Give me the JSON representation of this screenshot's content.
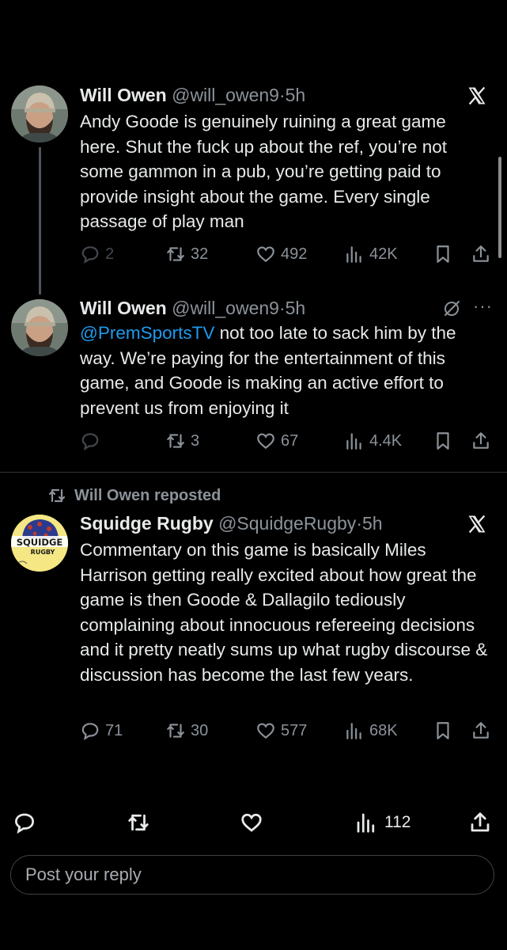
{
  "posts": [
    {
      "name": "Will Owen",
      "handle": "@will_owen9",
      "dot": "·",
      "time": "5h",
      "text": "Andy Goode is genuinely ruining a great game here. Shut the fuck up about the ref, you’re not some gammon in a pub, you’re getting paid to provide insight about the game. Every single passage of play man",
      "replies": "2",
      "reposts": "32",
      "likes": "492",
      "views": "42K"
    },
    {
      "name": "Will Owen",
      "handle": "@will_owen9",
      "dot": "·",
      "time": "5h",
      "mention": "@PremSportsTV",
      "text": " not too late to sack him by the way. We’re paying for the entertainment of this game, and Goode is making an active effort to prevent us from enjoying it",
      "more": "···",
      "replies": "",
      "reposts": "3",
      "likes": "67",
      "views": "4.4K"
    },
    {
      "repost_label": "Will Owen reposted",
      "name": "Squidge Rugby",
      "handle": "@SquidgeRugby",
      "dot": "·",
      "time": "5h",
      "avatar_text": [
        "SQUIDGE",
        "RUGBY"
      ],
      "text": "Commentary on this game is basically Miles Harrison getting really excited about how great the game is then Goode & Dallagilo tediously complaining about innocuous refereeing decisions and it pretty neatly sums up what rugby discourse & discussion has become the last few years.",
      "replies": "71",
      "reposts": "30",
      "likes": "577",
      "views": "68K"
    }
  ],
  "bottom_bar": {
    "views": "112"
  },
  "reply": {
    "placeholder": "Post your reply"
  },
  "colors": {
    "background": "#000000",
    "text": "#e7e9ea",
    "muted": "#8b9299",
    "link": "#1d9bf0"
  }
}
